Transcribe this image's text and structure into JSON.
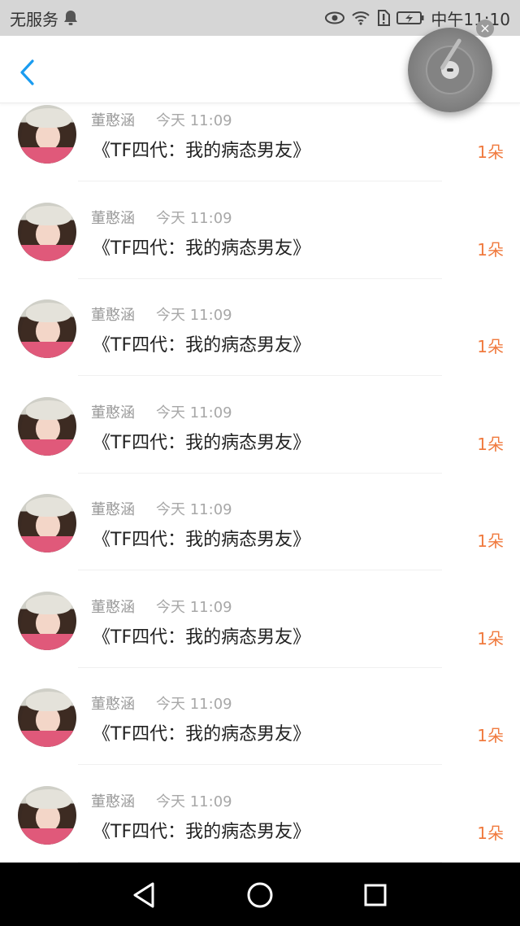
{
  "status_bar": {
    "carrier": "无服务",
    "time": "中午11:10"
  },
  "header": {
    "back_icon": "chevron-left-icon"
  },
  "music_player": {
    "icon": "vinyl-disc-icon",
    "close_label": "×"
  },
  "colors": {
    "accent_blue": "#1a9cf0",
    "count_orange": "#f07a3e",
    "status_bar_bg": "#d6d6d6"
  },
  "items": [
    {
      "name": "董憨涵",
      "time": "今天 11:09",
      "title": "《TF四代：我的病态男友》",
      "count": "1朵"
    },
    {
      "name": "董憨涵",
      "time": "今天 11:09",
      "title": "《TF四代：我的病态男友》",
      "count": "1朵"
    },
    {
      "name": "董憨涵",
      "time": "今天 11:09",
      "title": "《TF四代：我的病态男友》",
      "count": "1朵"
    },
    {
      "name": "董憨涵",
      "time": "今天 11:09",
      "title": "《TF四代：我的病态男友》",
      "count": "1朵"
    },
    {
      "name": "董憨涵",
      "time": "今天 11:09",
      "title": "《TF四代：我的病态男友》",
      "count": "1朵"
    },
    {
      "name": "董憨涵",
      "time": "今天 11:09",
      "title": "《TF四代：我的病态男友》",
      "count": "1朵"
    },
    {
      "name": "董憨涵",
      "time": "今天 11:09",
      "title": "《TF四代：我的病态男友》",
      "count": "1朵"
    },
    {
      "name": "董憨涵",
      "time": "今天 11:09",
      "title": "《TF四代：我的病态男友》",
      "count": "1朵"
    }
  ]
}
